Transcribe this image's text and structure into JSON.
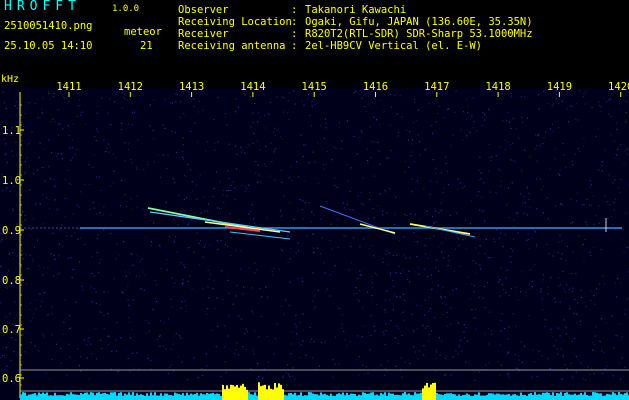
{
  "header": {
    "app_name": "HROFFT",
    "version": "1.0.0",
    "file_name": "2510051410.png",
    "datetime": "25.10.05 14:10",
    "meteor_label": "meteor",
    "meteor_count": "21"
  },
  "info": [
    {
      "key": "Observer",
      "value": "Takanori Kawachi"
    },
    {
      "key": "Receiving Location",
      "value": "Ogaki, Gifu, JAPAN (136.60E, 35.35N)"
    },
    {
      "key": "Receiver",
      "value": "R820T2(RTL-SDR) SDR-Sharp 53.1000MHz"
    },
    {
      "key": "Receiving antenna",
      "value": "2el-HB9CV Vertical (el. E-W)"
    }
  ],
  "axes": {
    "unit": "kHz",
    "x_ticks": [
      "1411",
      "1412",
      "1413",
      "1414",
      "1415",
      "1416",
      "1417",
      "1418",
      "1419",
      "1420"
    ],
    "y_ticks": [
      "1.1",
      "1.0",
      "0.9",
      "0.8",
      "0.7",
      "0.6"
    ]
  },
  "colors": {
    "background": "#00001a",
    "text": "#ffff00",
    "title": "#00ffff",
    "carrier": "#3aa0ff",
    "spectrum_base": "#00d8ff",
    "spectrum_peak": "#ffff00"
  }
}
